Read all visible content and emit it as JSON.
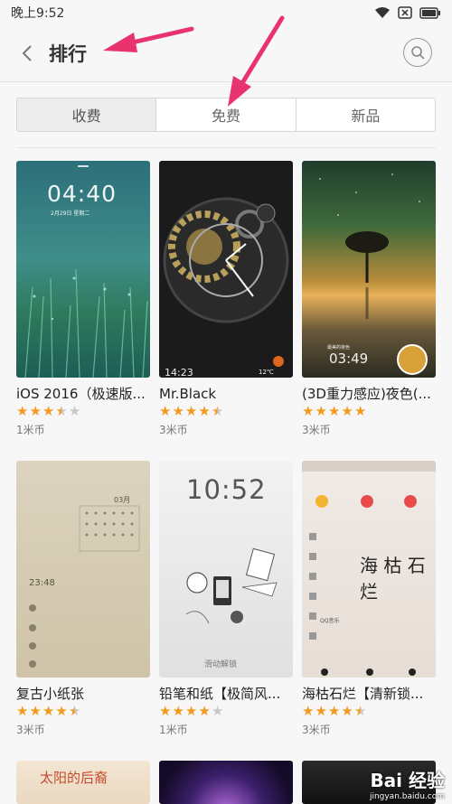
{
  "status_bar": {
    "time": "晚上9:52"
  },
  "header": {
    "title": "排行"
  },
  "tabs": [
    {
      "label": "收费",
      "active": true
    },
    {
      "label": "免费",
      "active": false
    },
    {
      "label": "新品",
      "active": false
    }
  ],
  "themes": [
    {
      "name": "iOS 2016（极速版...",
      "price": "1米币",
      "rating": 3.5,
      "thumb_time": "04:40",
      "thumb_date": "2月29日 星期二"
    },
    {
      "name": "Mr.Black",
      "price": "3米币",
      "rating": 4.5,
      "thumb_time": "14:23",
      "thumb_date": "12℃"
    },
    {
      "name": "(3D重力感应)夜色(...",
      "price": "3米币",
      "rating": 5,
      "thumb_time": "03:49",
      "thumb_date": "最美的夜色"
    },
    {
      "name": "复古小纸张",
      "price": "3米币",
      "rating": 4.5,
      "thumb_time": "23:48",
      "thumb_date": "03月"
    },
    {
      "name": "铅笔和纸【极简风...",
      "price": "1米币",
      "rating": 4,
      "thumb_time": "10:52",
      "thumb_date": "滑动解锁"
    },
    {
      "name": "海枯石烂【清新锁...",
      "price": "3米币",
      "rating": 4.5,
      "thumb_time": "海 枯 石 烂",
      "thumb_date": "QQ音乐"
    }
  ],
  "partial_row": {
    "thumb1_text": "太阳的后裔"
  },
  "watermark": {
    "line1": "Bai 经验",
    "line2": "jingyan.baidu.com"
  },
  "colors": {
    "star": "#f39a1e",
    "annotation_arrow": "#e8336e"
  }
}
